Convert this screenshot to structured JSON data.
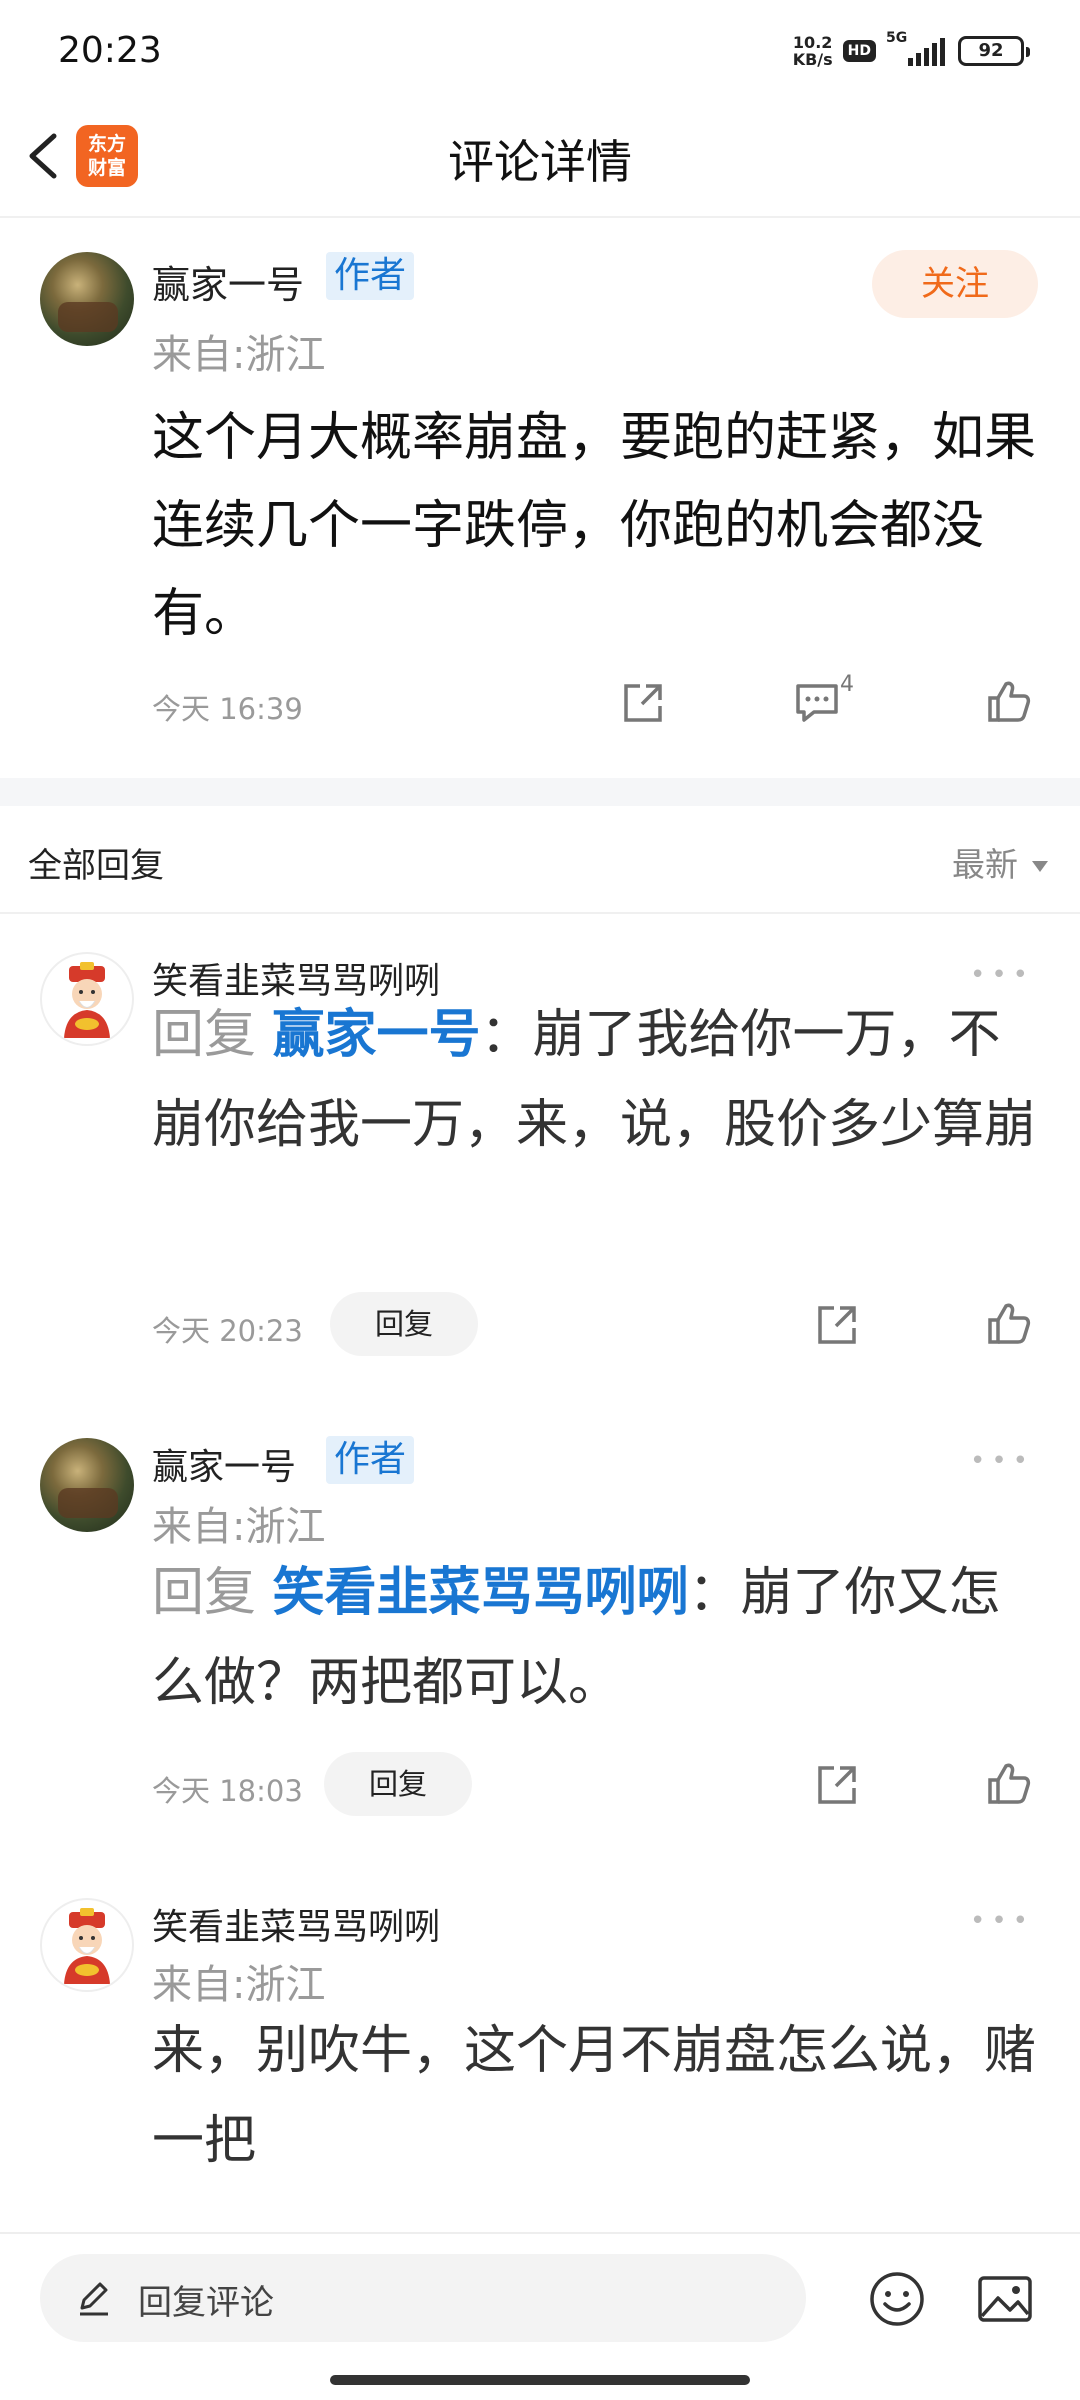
{
  "status_bar": {
    "time": "20:23",
    "net_speed_value": "10.2",
    "net_speed_unit": "KB/s",
    "hd": "HD",
    "network": "5G",
    "battery": "92"
  },
  "nav": {
    "logo_line1": "东方",
    "logo_line2": "财富",
    "title": "评论详情",
    "logo_color": "#f26522"
  },
  "main_comment": {
    "username": "赢家一号",
    "author_tag": "作者",
    "location": "来自:浙江",
    "follow_label": "关注",
    "text": "这个月大概率崩盘，要跑的赶紧，如果连续几个一字跌停，你跑的机会都没有。",
    "time": "今天 16:39",
    "comment_count": "4"
  },
  "replies_header": {
    "title": "全部回复",
    "sort_label": "最新"
  },
  "replies": [
    {
      "username": "笑看韭菜骂骂咧咧",
      "prefix": "回复 ",
      "mention": "赢家一号",
      "text": "：崩了我给你一万，不崩你给我一万，来，说，股价多少算崩",
      "time": "今天 20:23",
      "reply_label": "回复"
    },
    {
      "username": "赢家一号",
      "author_tag": "作者",
      "location": "来自:浙江",
      "prefix": "回复 ",
      "mention": "笑看韭菜骂骂咧咧",
      "text": "：崩了你又怎么做？两把都可以。",
      "time": "今天 18:03",
      "reply_label": "回复"
    },
    {
      "username": "笑看韭菜骂骂咧咧",
      "location": "来自:浙江",
      "text": "来，别吹牛，这个月不崩盘怎么说，赌一把"
    }
  ],
  "bottom_bar": {
    "input_placeholder": "回复评论"
  },
  "colors": {
    "accent_blue": "#1976d2",
    "follow_orange": "#f06a1a",
    "muted_gray": "#9a9a9a"
  },
  "icons": [
    "back-icon",
    "share-icon",
    "comment-icon",
    "like-icon",
    "more-icon",
    "pen-icon",
    "emoji-icon",
    "image-icon"
  ]
}
